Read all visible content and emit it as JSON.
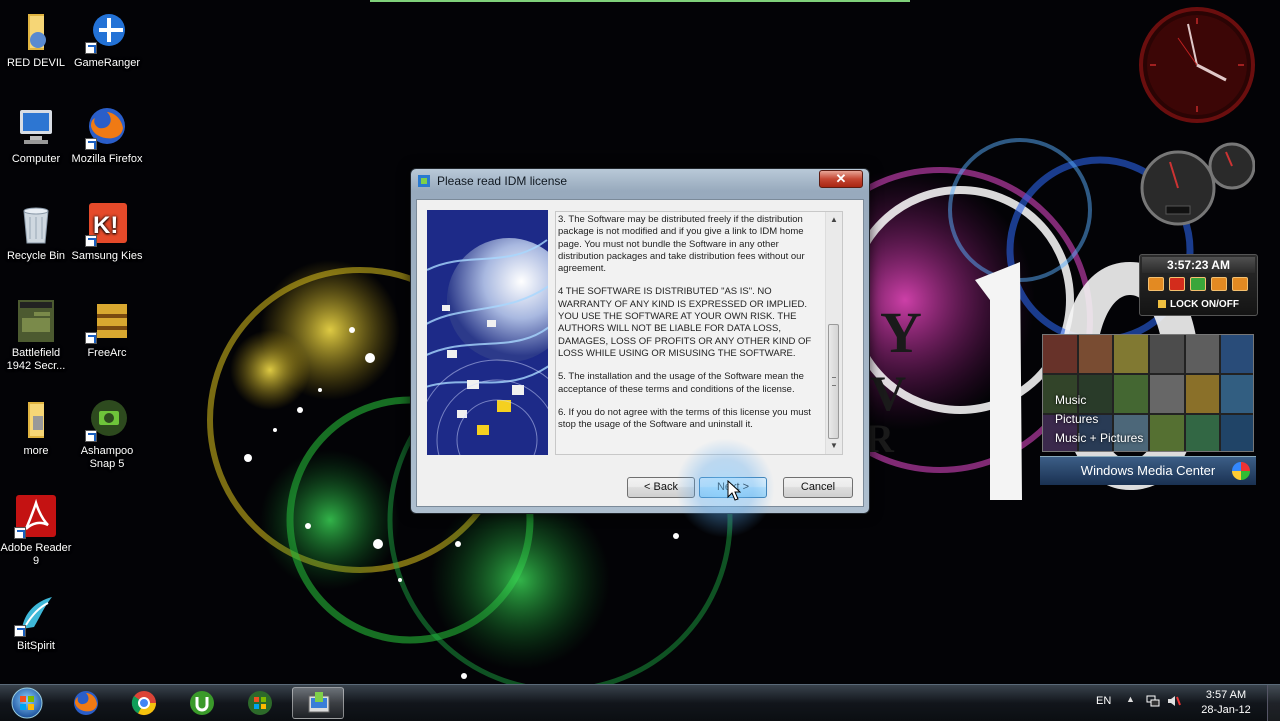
{
  "desktop": {
    "icons": [
      {
        "label": "RED DEVIL",
        "icon": "folder-icon"
      },
      {
        "label": "GameRanger",
        "icon": "gameranger-icon"
      },
      {
        "label": "Computer",
        "icon": "computer-icon"
      },
      {
        "label": "Mozilla Firefox",
        "icon": "firefox-icon"
      },
      {
        "label": "Recycle Bin",
        "icon": "recycle-bin-icon"
      },
      {
        "label": "Samsung Kies",
        "icon": "samsung-kies-icon"
      },
      {
        "label": "Battlefield 1942 Secr...",
        "icon": "battlefield-icon"
      },
      {
        "label": "FreeArc",
        "icon": "freearc-icon"
      },
      {
        "label": "more",
        "icon": "folder-icon"
      },
      {
        "label": "Ashampoo Snap 5",
        "icon": "ashampoo-icon"
      },
      {
        "label": "Adobe Reader 9",
        "icon": "adobe-reader-icon"
      },
      {
        "label": "BitSpirit",
        "icon": "bitspirit-icon"
      }
    ]
  },
  "gadgets": {
    "lock_clock": {
      "time": "3:57:23 AM",
      "lock_label": "LOCK ON/OFF"
    },
    "media_center": {
      "menu": [
        "Music",
        "Pictures",
        "Music + Pictures"
      ],
      "title": "Windows Media Center"
    }
  },
  "dialog": {
    "title": "Please read IDM license",
    "close_label": "✕",
    "license_paragraphs": [
      "3. The Software may be distributed freely if the distribution package is not modified and if you give a link to IDM home page. You must not bundle the Software in any other distribution packages and take distribution fees without our agreement.",
      "4 THE SOFTWARE IS DISTRIBUTED \"AS IS\". NO WARRANTY OF ANY KIND IS EXPRESSED OR IMPLIED. YOU USE THE SOFTWARE AT YOUR OWN RISK. THE AUTHORS WILL NOT BE LIABLE FOR DATA LOSS, DAMAGES, LOSS OF PROFITS OR ANY OTHER KIND OF LOSS WHILE USING OR MISUSING THE SOFTWARE.",
      "5. The installation and the usage of the Software mean the acceptance of these terms and conditions of the license.",
      "6. If you do not agree with the terms of this license you must stop the usage of the Software and uninstall it."
    ],
    "back_label": "< Back",
    "next_label": "Next >",
    "cancel_label": "Cancel"
  },
  "taskbar": {
    "items": [
      "firefox-icon",
      "chrome-icon",
      "utorrent-icon",
      "windows-live-icon",
      "idm-installer-icon"
    ],
    "language": "EN",
    "tray_arrow": "▲",
    "time": "3:57 AM",
    "date": "28-Jan-12"
  },
  "colors": {
    "accent": "#3c7fb1",
    "titlebar": "#9fb3c7",
    "close": "#c54733"
  }
}
